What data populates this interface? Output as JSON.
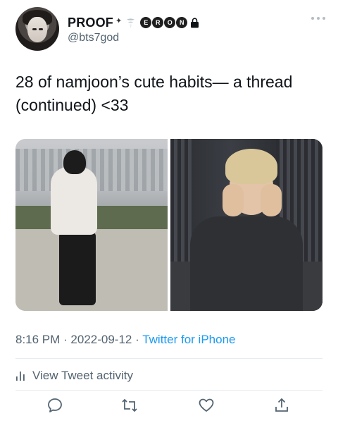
{
  "author": {
    "display_name": "PROOF",
    "badge_letters": [
      "E",
      "R",
      "O",
      "N"
    ],
    "handle": "@bts7god"
  },
  "tweet": {
    "text_line_1": "28 of namjoon’s cute habits— a thread",
    "text_line_2": "(continued) <33"
  },
  "meta": {
    "time": "8:16 PM",
    "separator": " · ",
    "date": "2022-09-12",
    "source": "Twitter for iPhone"
  },
  "activity": {
    "label": "View Tweet activity"
  },
  "icons": {
    "more": "more-dots-icon",
    "reply": "reply-icon",
    "retweet": "retweet-icon",
    "like": "like-icon",
    "share": "share-icon",
    "activity": "bar-chart-icon",
    "lock": "lock-icon"
  },
  "colors": {
    "text": "#0f1419",
    "secondary": "#536471",
    "link": "#1d9bf0",
    "divider": "#e6ecf0"
  }
}
